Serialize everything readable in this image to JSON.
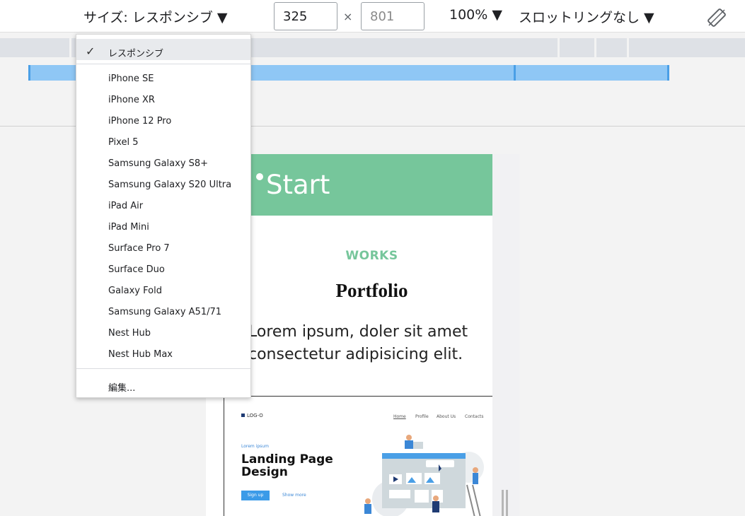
{
  "toolbar": {
    "size_label": "サイズ: レスポンシブ ▼",
    "width_value": "325",
    "height_value": "801",
    "times": "×",
    "zoom_label": "100% ▼",
    "throttle_label": "スロットリングなし ▼"
  },
  "menu": {
    "selected_label": "レスポンシブ",
    "check": "✓",
    "devices": [
      "iPhone SE",
      "iPhone XR",
      "iPhone 12 Pro",
      "Pixel 5",
      "Samsung Galaxy S8+",
      "Samsung Galaxy S20 Ultra",
      "iPad Air",
      "iPad Mini",
      "Surface Pro 7",
      "Surface Duo",
      "Galaxy Fold",
      "Samsung Galaxy A51/71",
      "Nest Hub",
      "Nest Hub Max"
    ],
    "edit_label": "編集..."
  },
  "page": {
    "hero_title": "Start",
    "works_label": "WORKS",
    "portfolio_title": "Portfolio",
    "lorem_line1": "Lorem ipsum, doler sit amet",
    "lorem_line2": "consectetur adipisicing elit."
  },
  "card": {
    "logo": "LOG-O",
    "nav": [
      "Home",
      "Profile",
      "About Us",
      "Contacts"
    ],
    "eyebrow": "Lorem ipsum",
    "title_line1": "Landing Page",
    "title_line2": "Design",
    "signup": "Sign up",
    "read_more": "Show more"
  },
  "colors": {
    "accent_green": "#76c69b",
    "breakpoint_blue": "#8fc7f5",
    "link_blue": "#3b87d6"
  }
}
